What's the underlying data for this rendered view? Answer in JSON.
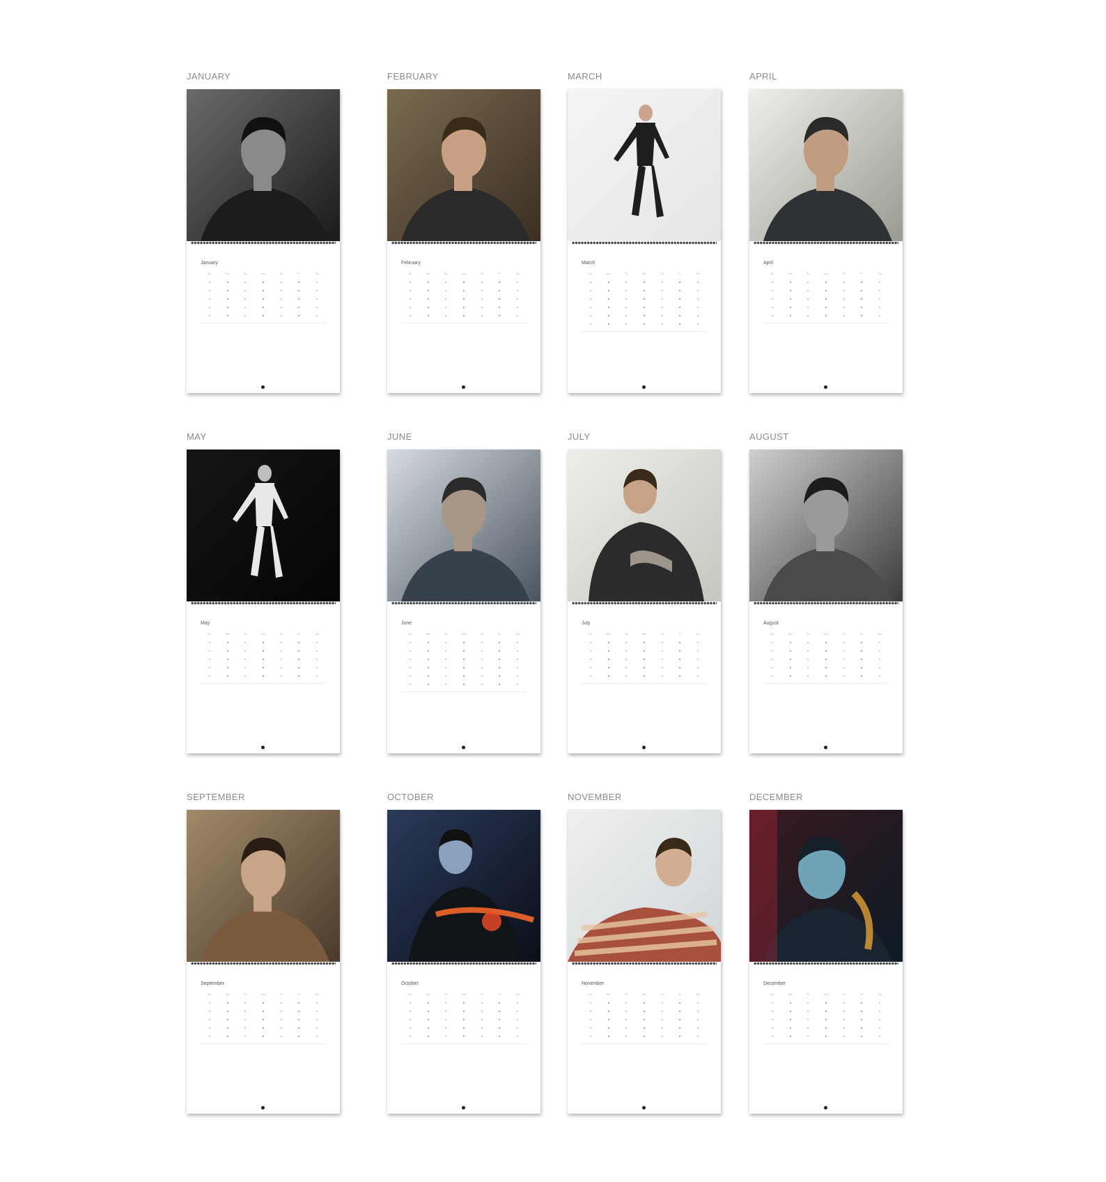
{
  "months": [
    {
      "heading": "JANUARY",
      "calendar_title": "January",
      "photo": "bw-portrait-dark-coat"
    },
    {
      "heading": "FEBRUARY",
      "calendar_title": "February",
      "photo": "seated-portrait-warm-tones"
    },
    {
      "heading": "MARCH",
      "calendar_title": "March",
      "photo": "jumping-figure-white-background"
    },
    {
      "heading": "APRIL",
      "calendar_title": "April",
      "photo": "portrait-studded-jacket"
    },
    {
      "heading": "MAY",
      "calendar_title": "May",
      "photo": "jumping-figure-black-background"
    },
    {
      "heading": "JUNE",
      "calendar_title": "June",
      "photo": "blurred-portrait"
    },
    {
      "heading": "JULY",
      "calendar_title": "July",
      "photo": "leather-jacket-back-view"
    },
    {
      "heading": "AUGUST",
      "calendar_title": "August",
      "photo": "bw-outdoor-portrait"
    },
    {
      "heading": "SEPTEMBER",
      "calendar_title": "September",
      "photo": "knit-sweater-arms-crossed"
    },
    {
      "heading": "OCTOBER",
      "calendar_title": "October",
      "photo": "motorcycle-night-lights"
    },
    {
      "heading": "NOVEMBER",
      "calendar_title": "November",
      "photo": "striped-sweater-reclining"
    },
    {
      "heading": "DECEMBER",
      "calendar_title": "December",
      "photo": "neon-light-portrait"
    }
  ],
  "weekday_labels": [
    "Su",
    "Mo",
    "Tu",
    "We",
    "Th",
    "Fr",
    "Sa"
  ]
}
